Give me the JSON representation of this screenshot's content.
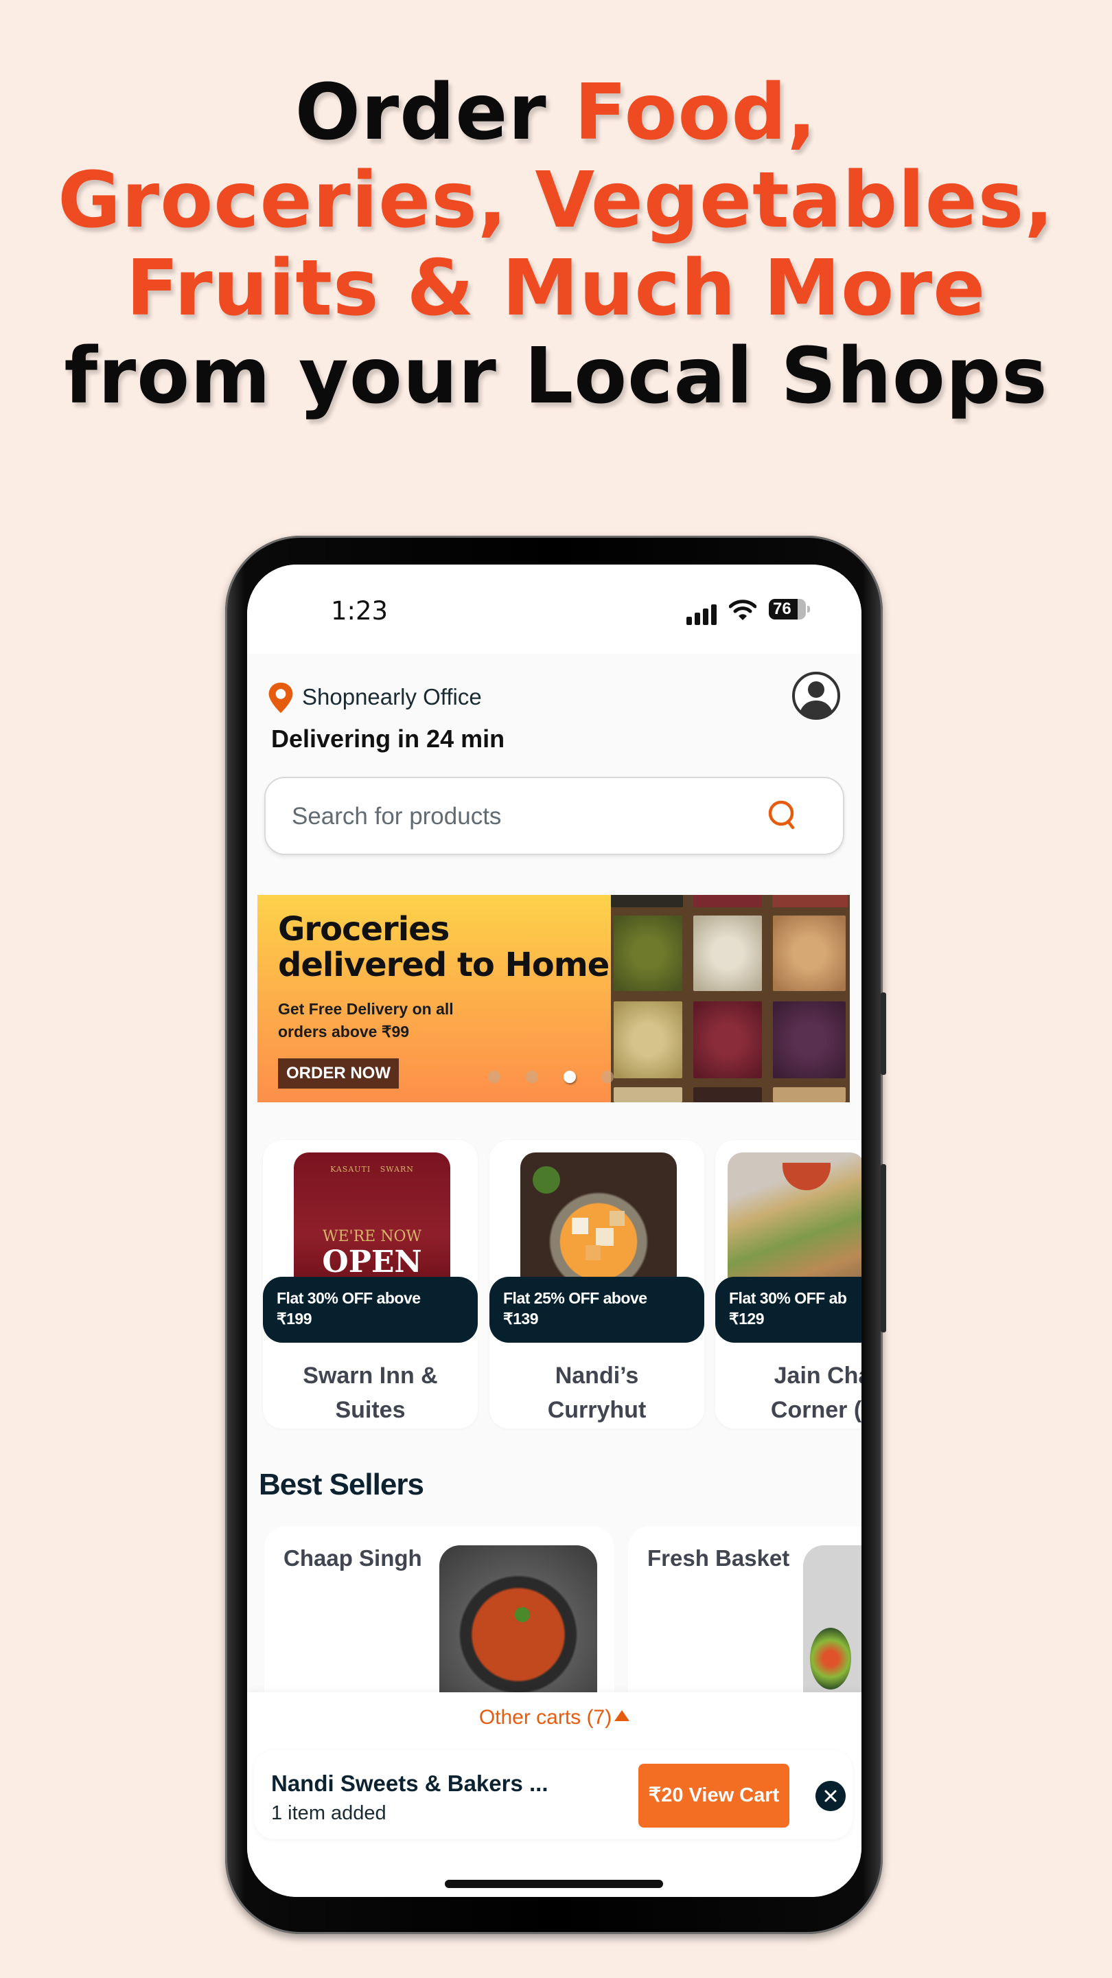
{
  "headline": {
    "line1_dark": "Order ",
    "line1_accent": "Food,",
    "line2": "Groceries, Vegetables,",
    "line3": "Fruits & Much More",
    "line4": "from your Local Shops"
  },
  "colors": {
    "accent": "#ee4b23",
    "app_orange": "#f36d22",
    "navy": "#06202d",
    "background": "#fcede4"
  },
  "status_bar": {
    "time": "1:23",
    "battery": "76",
    "icons": [
      "signal-icon",
      "wifi-icon",
      "battery-icon"
    ]
  },
  "header": {
    "location": "Shopnearly Office",
    "delivery_eta": "Delivering in 24 min",
    "icons": [
      "location-pin-icon",
      "profile-icon"
    ]
  },
  "search": {
    "placeholder": "Search for products",
    "icon": "search-icon"
  },
  "banner": {
    "title_line1": "Groceries",
    "title_line2": "delivered to Home",
    "subtitle_line1": "Get Free Delivery on all",
    "subtitle_line2": "orders above ₹99",
    "cta": "ORDER NOW",
    "carousel": {
      "total_dots": 4,
      "active_index": 2
    }
  },
  "stores": [
    {
      "offer_line1": "Flat 30% OFF above",
      "offer_line2": "₹199",
      "name_line1": "Swarn Inn &",
      "name_line2": "Suites"
    },
    {
      "offer_line1": "Flat 25% OFF above",
      "offer_line2": "₹139",
      "name_line1": "Nandi’s",
      "name_line2": "Curryhut"
    },
    {
      "offer_line1": "Flat 30% OFF ab",
      "offer_line2": "₹129",
      "name_line1": "Jain Cha",
      "name_line2": "Corner (J"
    }
  ],
  "store_image_text": {
    "brand1": "KASAUTI",
    "brand2": "SWARN",
    "line1": "WE'RE NOW",
    "line2": "OPEN"
  },
  "best_sellers": {
    "title": "Best Sellers",
    "items": [
      {
        "name": "Chaap Singh"
      },
      {
        "name": "Fresh Basket"
      }
    ]
  },
  "cart_bar": {
    "other_carts": "Other carts (7)",
    "store": "Nandi Sweets & Bakers ...",
    "items": "1 item added",
    "button": "₹20 View Cart"
  }
}
